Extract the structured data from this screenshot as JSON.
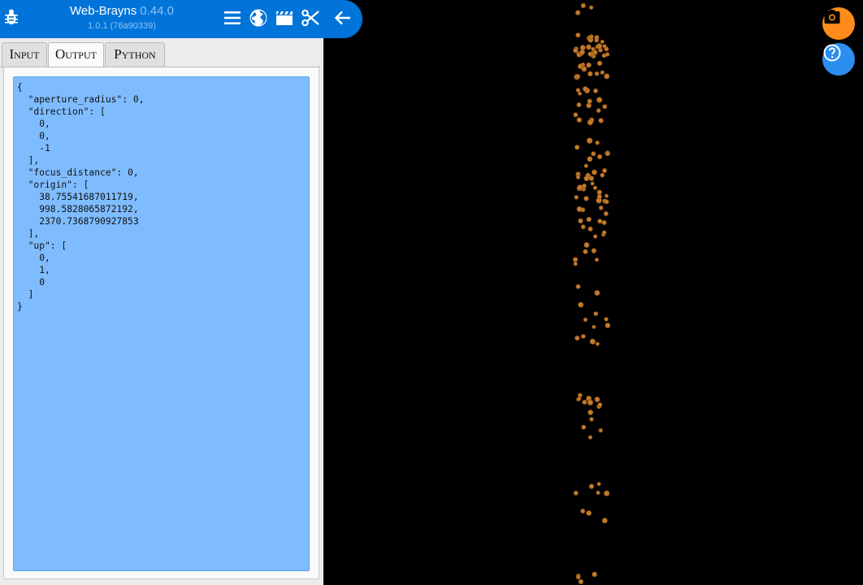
{
  "header": {
    "app_name": "Web-Brayns",
    "app_version": "0.44.0",
    "sub_version": "1.0.1 (76a90339)",
    "icons": [
      "bug-icon",
      "menu-icon",
      "globe-icon",
      "movie-clapper-icon",
      "scissors-icon",
      "arrow-back-icon"
    ]
  },
  "tabs": [
    {
      "label": "Input"
    },
    {
      "label": "Output",
      "active": true
    },
    {
      "label": "Python"
    }
  ],
  "output": {
    "text": "{\n  \"aperture_radius\": 0,\n  \"direction\": [\n    0,\n    0,\n    -1\n  ],\n  \"focus_distance\": 0,\n  \"origin\": [\n    38.75541687011719,\n    998.5828065872192,\n    2370.7368790927853\n  ],\n  \"up\": [\n    0,\n    1,\n    0\n  ]\n}"
  },
  "viewport": {
    "buttons": [
      {
        "name": "snapshot-button",
        "icon": "camera-icon",
        "color": "#ff8c1a"
      },
      {
        "name": "help-button",
        "icon": "help-icon",
        "color": "#2b8ef0"
      }
    ],
    "particle_color": "#c47a2a"
  },
  "colors": {
    "header_blue": "#0074d9",
    "output_bg": "#7fbcff",
    "panel_bg": "#ececec"
  }
}
